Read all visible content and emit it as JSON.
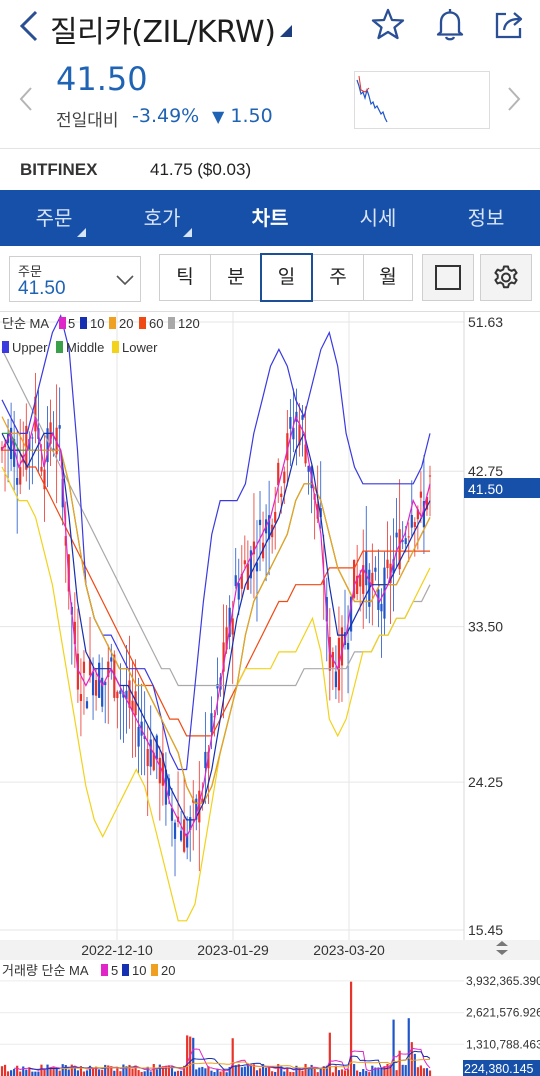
{
  "header": {
    "title": "질리카(ZIL/KRW)",
    "icons": [
      "back-icon",
      "dropdown-caret-icon",
      "star-icon",
      "bell-icon",
      "share-icon"
    ]
  },
  "price": {
    "current": "41.50",
    "change_label": "전일대비",
    "change_pct": "-3.49%",
    "change_arrow": "▼",
    "change_amount": "1.50"
  },
  "exchange": {
    "name": "BITFINEX",
    "price": "41.75 ($0.03)"
  },
  "tabs": [
    {
      "label": "주문",
      "has_menu": true
    },
    {
      "label": "호가",
      "has_menu": true
    },
    {
      "label": "차트",
      "active": true
    },
    {
      "label": "시세"
    },
    {
      "label": "정보"
    }
  ],
  "toolbar": {
    "order_label": "주문",
    "order_value": "41.50",
    "periods": [
      "틱",
      "분",
      "일",
      "주",
      "월"
    ],
    "active_period": "일"
  },
  "colors": {
    "brand": "#1750a8",
    "price_blue": "#1f63b5",
    "up_red": "#e8332b",
    "down_blue": "#1f55c8",
    "ma5": "#e026c8",
    "ma10": "#1530b0",
    "ma20": "#f0a020",
    "ma60": "#f04a14",
    "ma120": "#a9a9a9",
    "bb_upper": "#3a3ae0",
    "bb_middle": "#3aa04a",
    "bb_lower": "#f2d21a"
  },
  "chart_data": {
    "type": "line",
    "title": "",
    "legend_price": {
      "prefix": "단순 MA",
      "ma": [
        "5",
        "10",
        "20",
        "60",
        "120"
      ],
      "bb": [
        "Upper",
        "Middle",
        "Lower"
      ]
    },
    "legend_volume": {
      "prefix": "거래량 단순 MA",
      "ma": [
        "5",
        "10",
        "20"
      ]
    },
    "y_ticks": [
      "51.63",
      "42.75",
      "33.50",
      "24.25",
      "15.45"
    ],
    "ylim": [
      15.45,
      51.63
    ],
    "current_label": "41.50",
    "current_value": 41.5,
    "x_ticks": [
      "2022-12-10",
      "2023-01-29",
      "2023-03-20"
    ],
    "volume_ticks": [
      "3,932,365.390",
      "2,621,576.926",
      "1,310,788.463"
    ],
    "volume_current_label": "224,380.145",
    "volume_ylim": [
      0,
      4300000
    ],
    "series": [
      {
        "name": "5",
        "values": [
          44,
          45,
          43,
          44,
          46,
          43,
          45,
          44,
          36,
          31,
          30,
          31,
          30,
          31,
          30,
          29,
          28,
          27,
          26,
          25,
          23,
          22,
          21,
          22,
          24,
          27,
          30,
          33,
          36,
          37,
          38,
          39,
          40,
          42,
          44,
          46,
          45,
          42,
          39,
          32,
          31,
          33,
          36,
          37,
          36,
          35,
          36,
          38,
          39,
          41,
          40,
          42
        ]
      },
      {
        "name": "10",
        "values": [
          45,
          44,
          44,
          43,
          44,
          45,
          45,
          44,
          40,
          35,
          32,
          31,
          31,
          31,
          30,
          30,
          29,
          28,
          27,
          26,
          24,
          23,
          22,
          22,
          23,
          25,
          28,
          31,
          34,
          36,
          37,
          38,
          39,
          40,
          42,
          44,
          45,
          43,
          40,
          36,
          33,
          33,
          34,
          35,
          36,
          36,
          36,
          37,
          38,
          39,
          40,
          41
        ]
      },
      {
        "name": "20",
        "values": [
          46,
          45,
          45,
          44,
          44,
          44,
          44,
          44,
          42,
          39,
          36,
          34,
          33,
          32,
          31,
          31,
          30,
          30,
          29,
          28,
          27,
          26,
          24,
          23,
          23,
          24,
          26,
          28,
          30,
          33,
          35,
          36,
          37,
          38,
          39,
          41,
          42,
          42,
          41,
          39,
          37,
          36,
          35,
          35,
          35,
          36,
          36,
          36,
          37,
          38,
          39,
          40
        ]
      },
      {
        "name": "60",
        "values": [
          44,
          44,
          44,
          43,
          43,
          42,
          41,
          40,
          39,
          38,
          37,
          36,
          35,
          34,
          33,
          32,
          31,
          30,
          30,
          29,
          28,
          28,
          27,
          27,
          27,
          27,
          28,
          29,
          30,
          31,
          32,
          33,
          34,
          35,
          35,
          36,
          36,
          36,
          36,
          37,
          37,
          37,
          37,
          38,
          38,
          38,
          38,
          38,
          38,
          38,
          38,
          38
        ]
      },
      {
        "name": "120",
        "values": [
          50,
          49,
          48,
          47,
          46,
          45,
          44,
          43,
          42,
          41,
          40,
          39,
          38,
          37,
          36,
          35,
          34,
          33,
          32,
          31,
          31,
          30,
          30,
          30,
          30,
          30,
          30,
          30,
          30,
          30,
          30,
          30,
          30,
          30,
          30,
          30,
          31,
          31,
          31,
          31,
          31,
          31,
          32,
          32,
          32,
          33,
          33,
          34,
          34,
          35,
          35,
          36
        ]
      },
      {
        "name": "Upper",
        "values": [
          47,
          46,
          45,
          45,
          47,
          49,
          51,
          52,
          50,
          44,
          36,
          34,
          33,
          33,
          32,
          31,
          31,
          31,
          30,
          28,
          26,
          25,
          25,
          30,
          35,
          39,
          41,
          41,
          41,
          42,
          45,
          47,
          49,
          50,
          49,
          47,
          46,
          48,
          50,
          51,
          49,
          45,
          43,
          42,
          42,
          42,
          42,
          42,
          42,
          42,
          43,
          45
        ]
      },
      {
        "name": "Middle",
        "values": [
          45,
          45,
          44,
          44,
          44,
          44,
          44,
          44,
          42,
          39,
          36,
          34,
          33,
          32,
          31,
          31,
          30,
          30,
          29,
          28,
          27,
          26,
          24,
          23,
          23,
          24,
          26,
          28,
          30,
          33,
          35,
          36,
          37,
          38,
          39,
          41,
          42,
          42,
          41,
          39,
          37,
          36,
          35,
          35,
          35,
          36,
          36,
          36,
          37,
          38,
          39,
          40
        ]
      },
      {
        "name": "Lower",
        "values": [
          43,
          42,
          41,
          41,
          40,
          38,
          36,
          33,
          30,
          27,
          24,
          22,
          21,
          22,
          23,
          24,
          25,
          24,
          22,
          20,
          18,
          16,
          16,
          17,
          20,
          23,
          26,
          28,
          30,
          31,
          31,
          31,
          31,
          32,
          32,
          32,
          33,
          34,
          32,
          28,
          27,
          28,
          30,
          32,
          32,
          33,
          33,
          34,
          34,
          35,
          36,
          37
        ]
      }
    ]
  }
}
